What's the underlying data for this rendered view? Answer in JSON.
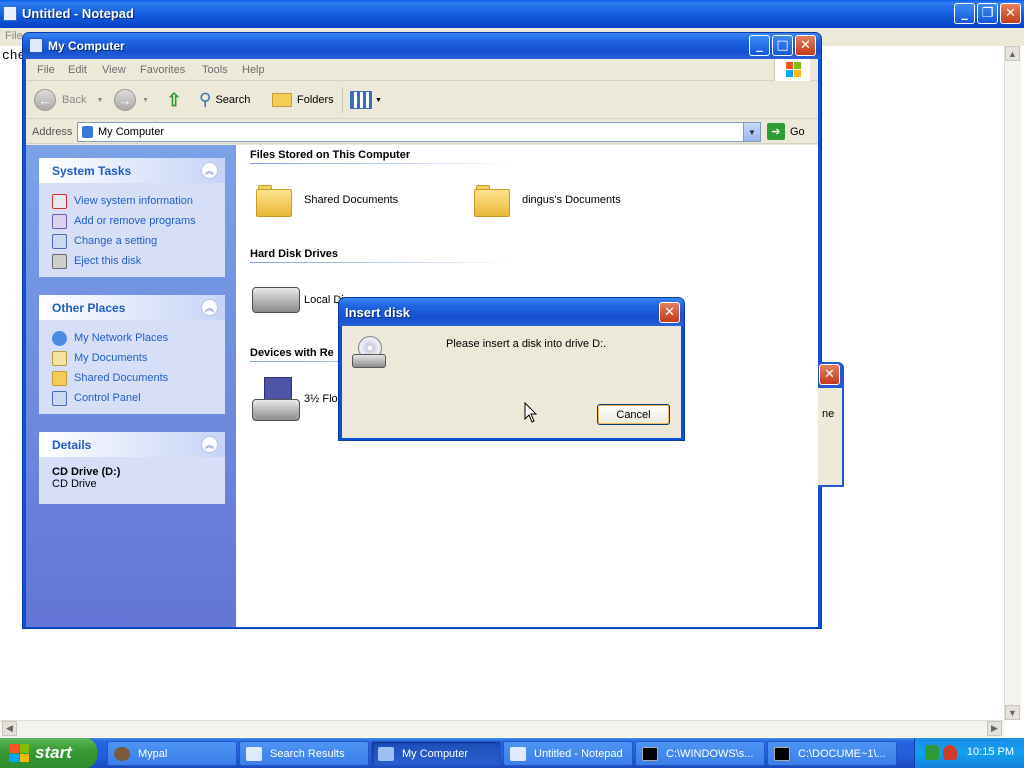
{
  "notepad": {
    "title": "Untitled - Notepad",
    "menu_fragment": "File",
    "text_fragment": "che"
  },
  "mycomputer": {
    "title": "My Computer",
    "menu": [
      "File",
      "Edit",
      "View",
      "Favorites",
      "Tools",
      "Help"
    ],
    "toolbar": {
      "back": "Back",
      "search": "Search",
      "folders": "Folders"
    },
    "address": {
      "label": "Address",
      "value": "My Computer",
      "go": "Go"
    },
    "system_tasks": {
      "title": "System Tasks",
      "items": [
        "View system information",
        "Add or remove programs",
        "Change a setting",
        "Eject this disk"
      ]
    },
    "other_places": {
      "title": "Other Places",
      "items": [
        "My Network Places",
        "My Documents",
        "Shared Documents",
        "Control Panel"
      ]
    },
    "details": {
      "title": "Details",
      "name": "CD Drive (D:)",
      "type": "CD Drive"
    },
    "groups": {
      "files": "Files Stored on This Computer",
      "hdd": "Hard Disk Drives",
      "devices": "Devices with Re"
    },
    "items": {
      "shared": "Shared Documents",
      "dingus": "dingus's Documents",
      "local": "Local Di",
      "floppy": "3½ Flo"
    }
  },
  "stray_window": {
    "text_fragment": "ne"
  },
  "dialog": {
    "title": "Insert disk",
    "message": "Please insert a disk into drive D:.",
    "cancel": "Cancel"
  },
  "taskbar": {
    "start": "start",
    "buttons": [
      "Mypal",
      "Search Results",
      "My Computer",
      "Untitled - Notepad",
      "C:\\WINDOWS\\s...",
      "C:\\DOCUME~1\\..."
    ],
    "active": "My Computer",
    "clock": "10:15 PM"
  },
  "colors": {
    "title_blue": "#0a50d8",
    "sidebar_link": "#215dc6",
    "start_green": "#3a9a37"
  }
}
